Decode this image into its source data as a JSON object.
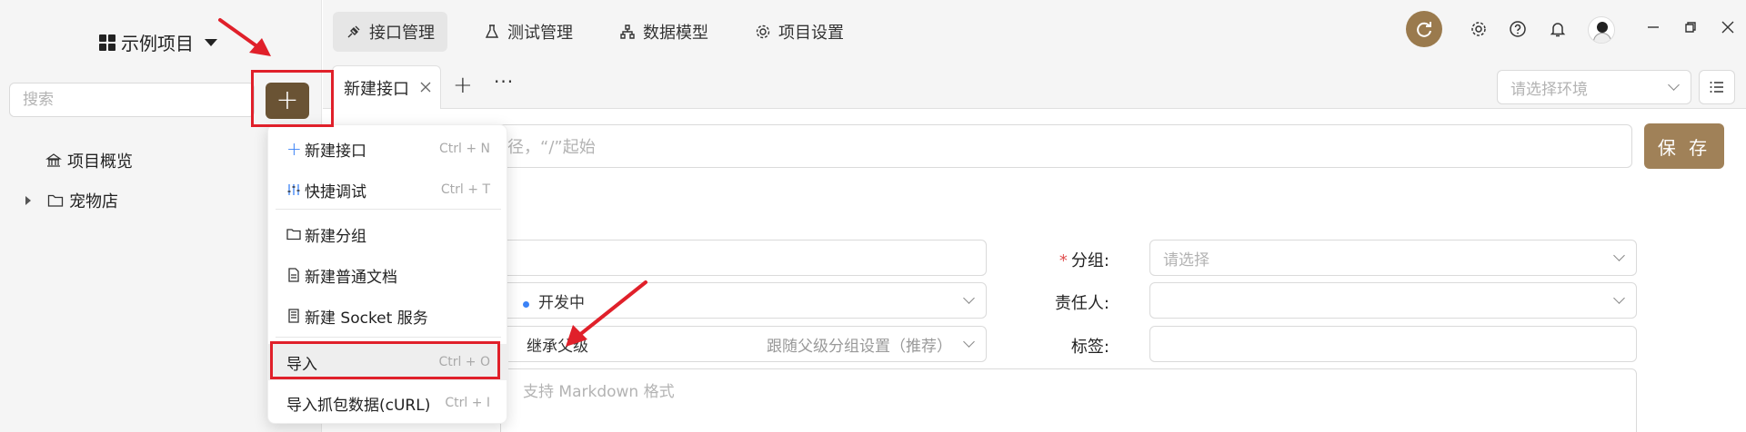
{
  "sidebar": {
    "project_name": "示例项目",
    "search_placeholder": "搜索",
    "add_label": "+",
    "tree": [
      {
        "label": "项目概览"
      },
      {
        "label": "宠物店"
      }
    ]
  },
  "topnav": {
    "tabs": [
      {
        "label": "接口管理"
      },
      {
        "label": "测试管理"
      },
      {
        "label": "数据模型"
      },
      {
        "label": "项目设置"
      }
    ],
    "sync_icon": "refresh-icon"
  },
  "tabbar": {
    "open_tab": "新建接口",
    "close": "X",
    "add": "+",
    "more": "···",
    "env_placeholder": "请选择环境"
  },
  "request": {
    "url_placeholder": "径，“/”起始",
    "save_label": "保 存"
  },
  "form": {
    "group_label": "分组:",
    "group_placeholder": "请选择",
    "status_value": "开发中",
    "owner_label": "责任人:",
    "inherit_label": "继承父级",
    "inherit_hint": "跟随父级分组设置（推荐）",
    "tags_label": "标签:",
    "desc_placeholder": "支持 Markdown 格式"
  },
  "menu": {
    "items": [
      {
        "label": "新建接口",
        "shortcut": "Ctrl + N",
        "icon": "plus-icon"
      },
      {
        "label": "快捷调试",
        "shortcut": "Ctrl + T",
        "icon": "sliders-icon"
      },
      {
        "label": "新建分组",
        "shortcut": "",
        "icon": "folder-icon"
      },
      {
        "label": "新建普通文档",
        "shortcut": "",
        "icon": "document-icon"
      },
      {
        "label": "新建 Socket 服务",
        "shortcut": "",
        "icon": "server-icon"
      },
      {
        "label": "导入",
        "shortcut": "Ctrl + O",
        "icon": ""
      },
      {
        "label": "导入抓包数据(cURL)",
        "shortcut": "Ctrl + I",
        "icon": ""
      }
    ]
  },
  "colors": {
    "brand_dark": "#6a5334",
    "brand": "#a08158",
    "annotation": "#e0202a",
    "status_blue": "#3b82f6"
  }
}
